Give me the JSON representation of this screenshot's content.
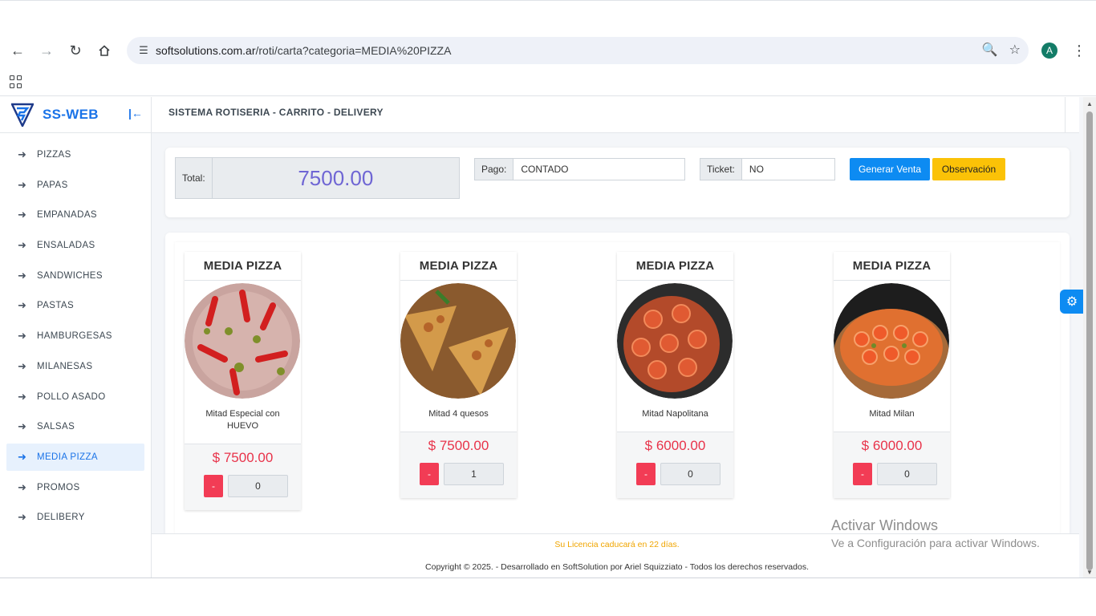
{
  "browser": {
    "url_host": "softsolutions.com.ar",
    "url_path": "/roti/carta?categoria=MEDIA%20PIZZA",
    "avatar_letter": "A"
  },
  "sidebar": {
    "brand": "SS-WEB",
    "items": [
      {
        "label": "PIZZAS"
      },
      {
        "label": "PAPAS"
      },
      {
        "label": "EMPANADAS"
      },
      {
        "label": "ENSALADAS"
      },
      {
        "label": "SANDWICHES"
      },
      {
        "label": "PASTAS"
      },
      {
        "label": "HAMBURGESAS"
      },
      {
        "label": "MILANESAS"
      },
      {
        "label": "POLLO ASADO"
      },
      {
        "label": "SALSAS"
      },
      {
        "label": "MEDIA PIZZA"
      },
      {
        "label": "PROMOS"
      },
      {
        "label": "DELIBERY"
      }
    ],
    "active_item": "MEDIA PIZZA"
  },
  "header": {
    "title": "SISTEMA ROTISERIA - CARRITO - DELIVERY"
  },
  "order": {
    "total_label": "Total:",
    "total_value": "7500.00",
    "pago_label": "Pago:",
    "pago_value": "CONTADO",
    "ticket_label": "Ticket:",
    "ticket_value": "NO",
    "generar_label": "Generar Venta",
    "observacion_label": "Observación"
  },
  "products": [
    {
      "category": "MEDIA PIZZA",
      "name": "Mitad Especial con HUEVO",
      "price": "$ 7500.00",
      "qty": "0",
      "minus": "-"
    },
    {
      "category": "MEDIA PIZZA",
      "name": "Mitad 4 quesos",
      "price": "$ 7500.00",
      "qty": "1",
      "minus": "-"
    },
    {
      "category": "MEDIA PIZZA",
      "name": "Mitad Napolitana",
      "price": "$ 6000.00",
      "qty": "0",
      "minus": "-"
    },
    {
      "category": "MEDIA PIZZA",
      "name": "Mitad Milan",
      "price": "$ 6000.00",
      "qty": "0",
      "minus": "-"
    }
  ],
  "footer": {
    "license": "Su Licencia caducará en 22 días.",
    "copyright": "Copyright © 2025. - Desarrollado en SoftSolution por Ariel Squizziato - Todos los derechos reservados."
  },
  "windows_watermark": {
    "line1": "Activar Windows",
    "line2": "Ve a Configuración para activar Windows."
  },
  "colors": {
    "accent": "#1a73e8",
    "price": "#e8334a",
    "total": "#6f66d4",
    "btn_primary": "#0d8bf2",
    "btn_warning": "#fbc207",
    "btn_danger": "#f23c55",
    "license": "#f0a500"
  }
}
